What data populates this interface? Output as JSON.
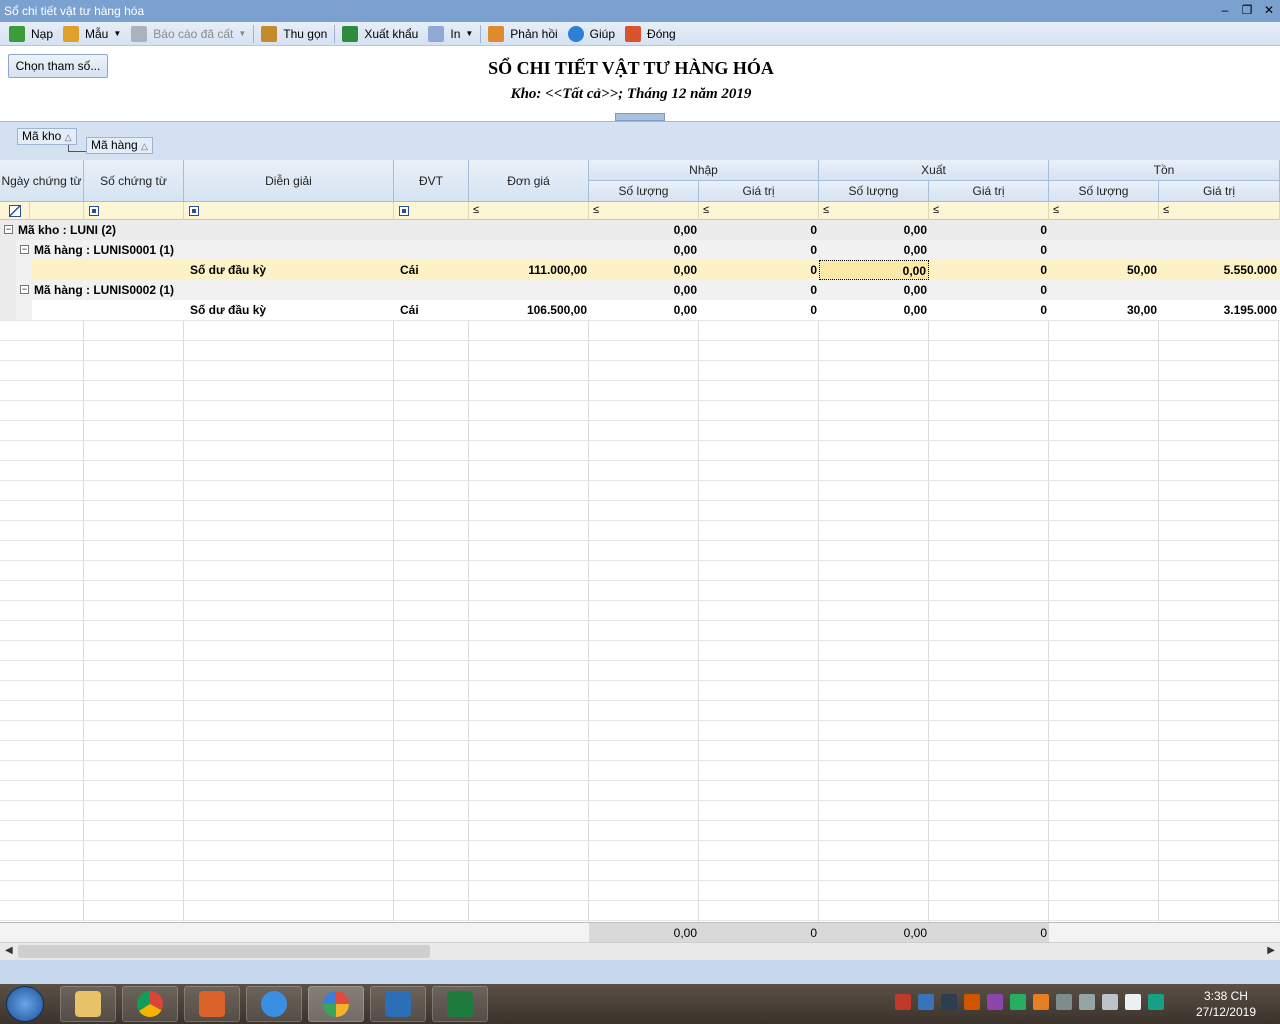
{
  "window": {
    "title": "Sổ chi tiết vật tư hàng hóa"
  },
  "toolbar": {
    "nap": "Nạp",
    "mau": "Mẫu",
    "bao_cao_da_cat": "Báo cáo đã cất",
    "thu_gon": "Thu gọn",
    "xuat_khau": "Xuất khẩu",
    "in": "In",
    "phan_hoi": "Phản hồi",
    "giup": "Giúp",
    "dong": "Đóng"
  },
  "report": {
    "param_button": "Chọn tham số...",
    "title": "SỔ CHI TIẾT VẬT TƯ HÀNG HÓA",
    "subtitle": "Kho: <<Tất cả>>; Tháng 12 năm 2019"
  },
  "group_panel": {
    "level1": "Mã kho",
    "level2": "Mã hàng"
  },
  "columns": {
    "ngay_chung_tu": "Ngày chứng từ",
    "so_chung_tu": "Số chứng từ",
    "dien_giai": "Diễn giải",
    "dvt": "ĐVT",
    "don_gia": "Đơn giá",
    "nhap": "Nhập",
    "xuat": "Xuất",
    "ton": "Tồn",
    "so_luong": "Số lượng",
    "gia_tri": "Giá trị"
  },
  "filter": {
    "le": "≤"
  },
  "rows": {
    "g1": {
      "label": "Mã kho : LUNI (2)",
      "nhap_sl": "0,00",
      "nhap_gt": "0",
      "xuat_sl": "0,00",
      "xuat_gt": "0"
    },
    "g2a": {
      "label": "Mã hàng : LUNIS0001 (1)",
      "nhap_sl": "0,00",
      "nhap_gt": "0",
      "xuat_sl": "0,00",
      "xuat_gt": "0"
    },
    "d1": {
      "dien_giai": "Số dư đầu kỳ",
      "dvt": "Cái",
      "don_gia": "111.000,00",
      "nhap_sl": "0,00",
      "nhap_gt": "0",
      "xuat_sl": "0,00",
      "xuat_gt": "0",
      "ton_sl": "50,00",
      "ton_gt": "5.550.000"
    },
    "g2b": {
      "label": "Mã hàng : LUNIS0002 (1)",
      "nhap_sl": "0,00",
      "nhap_gt": "0",
      "xuat_sl": "0,00",
      "xuat_gt": "0"
    },
    "d2": {
      "dien_giai": "Số dư đầu kỳ",
      "dvt": "Cái",
      "don_gia": "106.500,00",
      "nhap_sl": "0,00",
      "nhap_gt": "0",
      "xuat_sl": "0,00",
      "xuat_gt": "0",
      "ton_sl": "30,00",
      "ton_gt": "3.195.000"
    }
  },
  "footer": {
    "nhap_sl": "0,00",
    "nhap_gt": "0",
    "xuat_sl": "0,00",
    "xuat_gt": "0"
  },
  "taskbar": {
    "apps": [
      "explorer-icon",
      "chrome-icon",
      "unikey-icon",
      "ie-icon",
      "picasa-icon",
      "misa-icon",
      "excel-icon"
    ],
    "clock_time": "3:38 CH",
    "clock_date": "27/12/2019"
  }
}
